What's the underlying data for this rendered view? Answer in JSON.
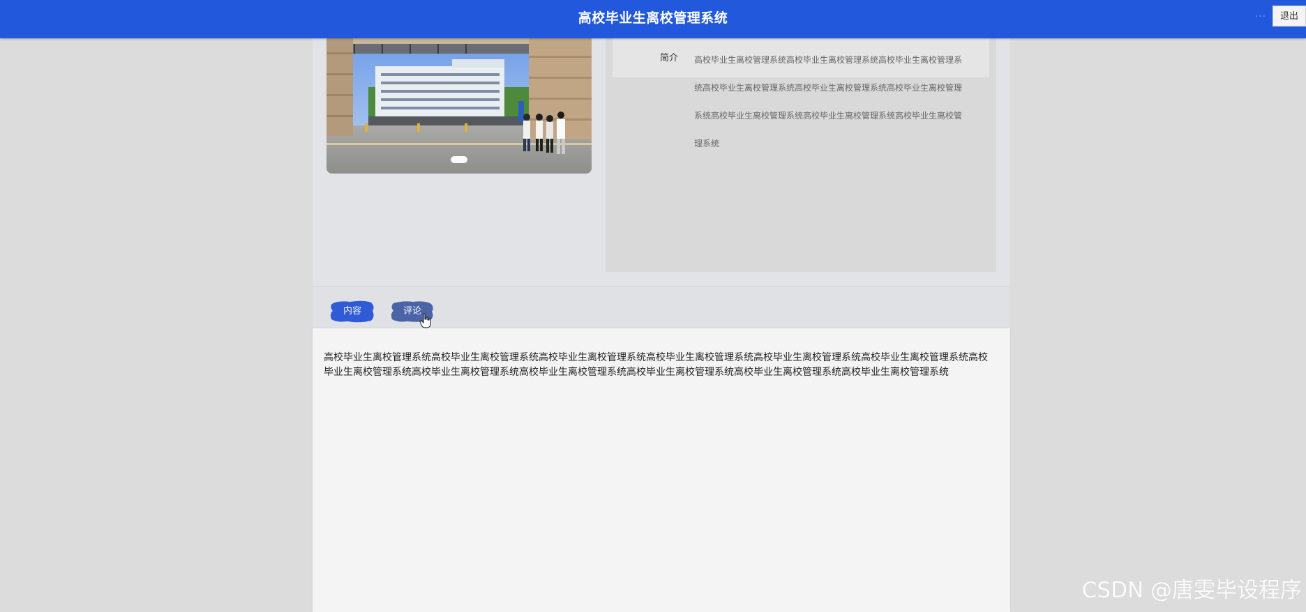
{
  "header": {
    "title": "高校毕业生离校管理系统",
    "dots": "···",
    "logout_label": "退出"
  },
  "intro": {
    "label": "简介",
    "text": "高校毕业生离校管理系统高校毕业生离校管理系统高校毕业生离校管理系统高校毕业生离校管理系统高校毕业生离校管理系统高校毕业生离校管理系统高校毕业生离校管理系统高校毕业生离校管理系统高校毕业生离校管理系统"
  },
  "tabs": [
    {
      "label": "内容",
      "color": "#2f5bd6"
    },
    {
      "label": "评论",
      "color": "#4b64a8"
    }
  ],
  "content": {
    "text": "高校毕业生离校管理系统高校毕业生离校管理系统高校毕业生离校管理系统高校毕业生离校管理系统高校毕业生离校管理系统高校毕业生离校管理系统高校毕业生离校管理系统高校毕业生离校管理系统高校毕业生离校管理系统高校毕业生离校管理系统高校毕业生离校管理系统高校毕业生离校管理系统"
  },
  "watermark": "CSDN @唐雯毕设程序",
  "colors": {
    "header_bg": "#2259dc",
    "tab_active": "#2f5bd6",
    "tab_inactive": "#4b64a8"
  }
}
